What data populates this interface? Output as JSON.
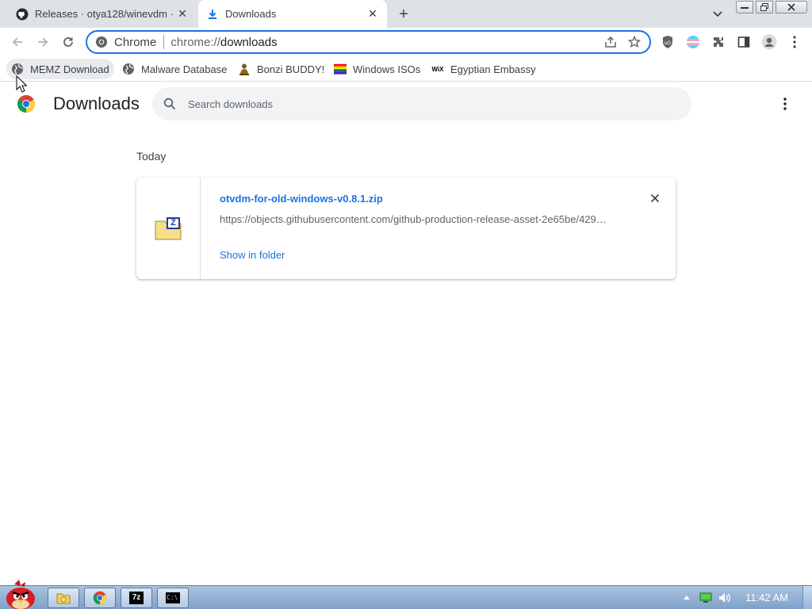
{
  "browser": {
    "tabs": [
      {
        "title": "Releases · otya128/winevdm ·",
        "favicon": "github-icon",
        "active": false
      },
      {
        "title": "Downloads",
        "favicon": "download-icon",
        "active": true
      }
    ],
    "address_bar": {
      "chip_label": "Chrome",
      "url_scheme": "chrome://",
      "url_host": "downloads"
    },
    "bookmarks": [
      {
        "label": "MEMZ Download",
        "icon": "globe-icon"
      },
      {
        "label": "Malware Database",
        "icon": "globe-icon"
      },
      {
        "label": "Bonzi BUDDY!",
        "icon": "bonzi-icon"
      },
      {
        "label": "Windows ISOs",
        "icon": "rainbow-flag-icon"
      },
      {
        "label": "Egyptian Embassy",
        "icon": "wix-icon",
        "icon_text": "WiX"
      }
    ]
  },
  "downloads_page": {
    "title": "Downloads",
    "search_placeholder": "Search downloads",
    "date_group": "Today",
    "items": [
      {
        "file_name": "otvdm-for-old-windows-v0.8.1.zip",
        "url": "https://objects.githubusercontent.com/github-production-release-asset-2e65be/429…",
        "action": "Show in folder",
        "icon": "zip-file-icon",
        "icon_letter": "Z"
      }
    ]
  },
  "taskbar": {
    "clock": "11:42 AM",
    "buttons": [
      "explorer-icon",
      "chrome-icon",
      "7zip-icon",
      "cmd-icon"
    ],
    "button_text": {
      "sevenzip": "7z",
      "cmd": "C:\\"
    }
  },
  "colors": {
    "accent": "#1a73e8",
    "tab_strip": "#dee1e6",
    "search_bg": "#f1f3f4",
    "taskbar": "#8fb0d4"
  }
}
